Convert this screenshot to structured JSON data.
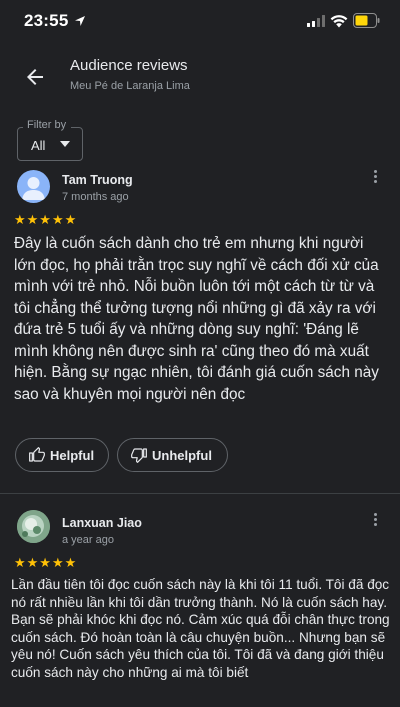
{
  "status_bar": {
    "time": "23:55"
  },
  "header": {
    "title": "Audience reviews",
    "subtitle": "Meu Pé de Laranja Lima"
  },
  "filter": {
    "label": "Filter by",
    "value": "All"
  },
  "reviews": [
    {
      "name": "Tam Truong",
      "date": "7 months ago",
      "stars": "★★★★★",
      "rating": 5,
      "text": "Đây là cuốn sách dành cho trẻ em nhưng khi người lớn đọc, họ phải trằn trọc suy nghĩ về cách đối xử của mình với trẻ nhỏ. Nỗi buồn luôn tới một cách từ từ và tôi chẳng thể tưởng tượng nổi những gì đã xảy ra với đứa trẻ 5 tuổi ấy và những dòng suy nghĩ: 'Đáng lẽ mình không nên được sinh ra' cũng theo đó mà xuất hiện. Bằng sự ngạc nhiên, tôi đánh giá cuốn sách này sao và khuyên mọi người nên đọc",
      "helpful_label": "Helpful",
      "unhelpful_label": "Unhelpful"
    },
    {
      "name": "Lanxuan Jiao",
      "date": "a year ago",
      "stars": "★★★★★",
      "rating": 5,
      "text": "Lần đầu tiên tôi đọc cuốn sách này là khi tôi 11 tuổi. Tôi đã đọc nó rất nhiều lần khi tôi dần trưởng thành. Nó là cuốn sách hay. Bạn sẽ phải khóc khi đọc nó. Cảm xúc quá đỗi chân thực trong cuốn sách. Đó hoàn toàn là câu chuyện buồn... Nhưng bạn sẽ yêu nó! Cuốn sách yêu thích của tôi. Tôi đã và đang giới thiệu cuốn sách này cho những ai mà tôi biết"
    }
  ],
  "icons": {
    "back": "arrow-left-icon",
    "more": "more-vert-icon",
    "helpful": "thumb-up-icon",
    "unhelpful": "thumb-down-icon"
  },
  "colors": {
    "background": "#202124",
    "star": "#ffc107",
    "avatar_default": "#8ab4f8"
  }
}
